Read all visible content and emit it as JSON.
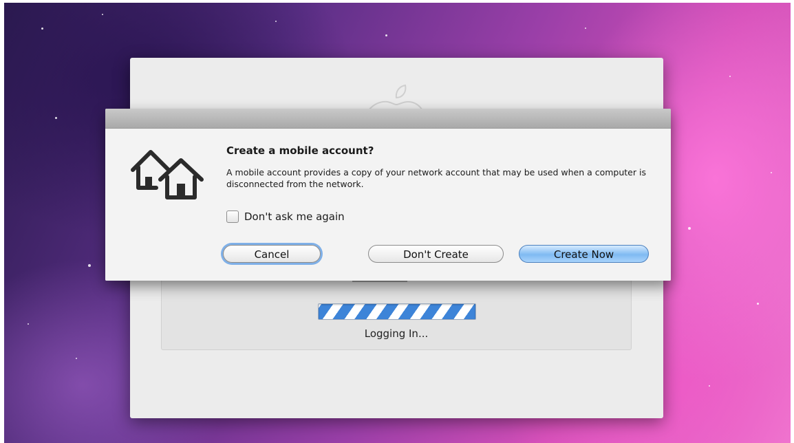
{
  "login_window": {
    "status_text": "Logging In..."
  },
  "dialog": {
    "title": "Create a mobile account?",
    "message": "A mobile account provides a copy of your network account that may be used when a computer is disconnected from the network.",
    "checkbox_label": "Don't ask me again",
    "checkbox_checked": false,
    "buttons": {
      "cancel": "Cancel",
      "dont_create": "Don't Create",
      "create_now": "Create Now"
    }
  },
  "icons": {
    "dialog_icon": "houses-icon",
    "login_logo": "apple-logo-icon"
  },
  "colors": {
    "default_button": "#7fbaf2",
    "focus_ring": "#7fb0e8",
    "progress_stripe": "#3d84d8"
  }
}
